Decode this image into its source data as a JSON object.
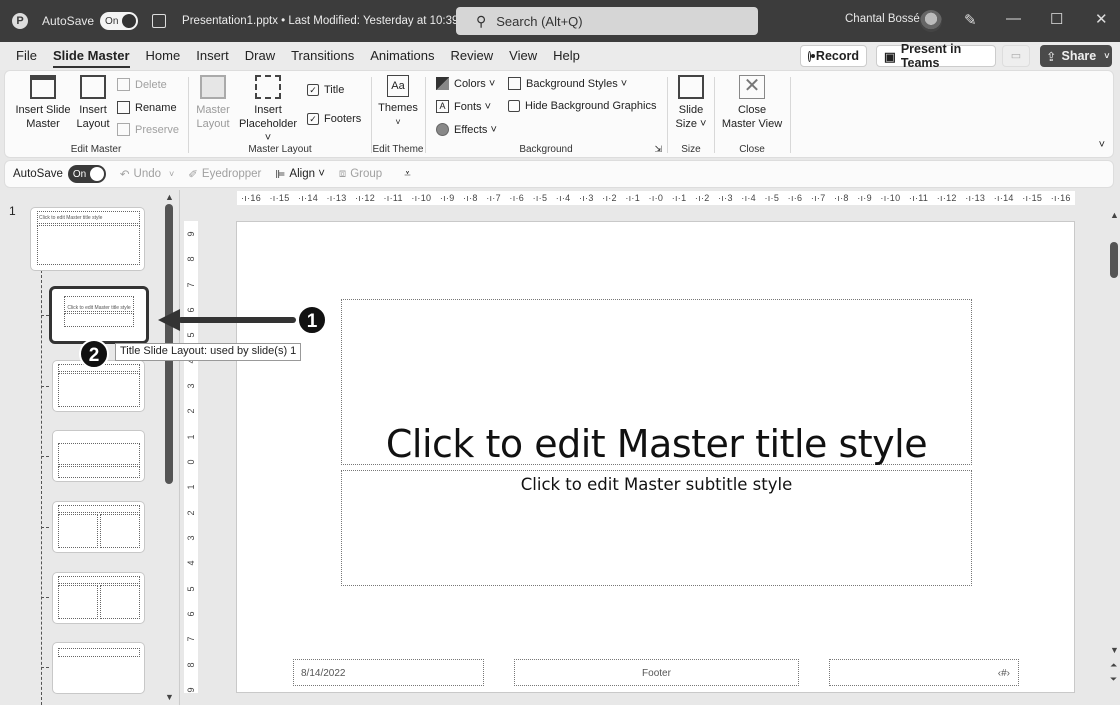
{
  "titlebar": {
    "autosave_label": "AutoSave",
    "autosave_state": "On",
    "document_title": "Presentation1.pptx • Last Modified: Yesterday at 10:39 ˅",
    "search_placeholder": "Search (Alt+Q)",
    "user_name": "Chantal Bossé",
    "minimize": "—",
    "maximize": "☐",
    "close": "✕"
  },
  "menu": {
    "tabs": [
      "File",
      "Slide Master",
      "Home",
      "Insert",
      "Draw",
      "Transitions",
      "Animations",
      "Review",
      "View",
      "Help"
    ],
    "active_tab": "Slide Master",
    "record_label": "Record",
    "present_teams_label": "Present in Teams",
    "share_label": "Share"
  },
  "ribbon": {
    "edit_master": {
      "label": "Edit Master",
      "insert_slide_master": "Insert Slide Master",
      "insert_slide_master_l1": "Insert Slide",
      "insert_slide_master_l2": "Master",
      "insert_layout_l1": "Insert",
      "insert_layout_l2": "Layout",
      "delete": "Delete",
      "rename": "Rename",
      "preserve": "Preserve"
    },
    "master_layout": {
      "label": "Master Layout",
      "master_layout_l1": "Master",
      "master_layout_l2": "Layout",
      "insert_placeholder_l1": "Insert",
      "insert_placeholder_l2": "Placeholder ˅",
      "title_checkbox": "Title",
      "title_checked": true,
      "footers_checkbox": "Footers",
      "footers_checked": true
    },
    "edit_theme": {
      "label": "Edit Theme",
      "themes": "Themes",
      "themes_chevron": "˅"
    },
    "background": {
      "label": "Background",
      "colors": "Colors ˅",
      "fonts": "Fonts ˅",
      "effects": "Effects ˅",
      "background_styles": "Background Styles ˅",
      "hide_background_graphics": "Hide Background Graphics",
      "hide_checked": false
    },
    "size": {
      "label": "Size",
      "slide_size_l1": "Slide",
      "slide_size_l2": "Size ˅"
    },
    "close": {
      "label": "Close",
      "close_master_l1": "Close",
      "close_master_l2": "Master View"
    },
    "collapse_icon": "˅"
  },
  "qat": {
    "autosave_label": "AutoSave",
    "autosave_state": "On",
    "undo": "Undo",
    "eyedropper": "Eyedropper",
    "align": "Align ˅",
    "group": "Group",
    "customize": "⩡"
  },
  "thumbnails": {
    "slide_number": "1",
    "master_title": "Click to edit Master title style",
    "layout_title": "Click to edit Master title style"
  },
  "rulers": {
    "horizontal": [
      "16",
      "15",
      "14",
      "13",
      "12",
      "11",
      "10",
      "9",
      "8",
      "7",
      "6",
      "5",
      "4",
      "3",
      "2",
      "1",
      "0",
      "1",
      "2",
      "3",
      "4",
      "5",
      "6",
      "7",
      "8",
      "9",
      "10",
      "11",
      "12",
      "13",
      "14",
      "15",
      "16"
    ],
    "vertical": [
      "9",
      "8",
      "7",
      "6",
      "5",
      "4",
      "3",
      "2",
      "1",
      "0",
      "1",
      "2",
      "3",
      "4",
      "5",
      "6",
      "7",
      "8",
      "9"
    ]
  },
  "slide": {
    "title": "Click to edit Master title style",
    "subtitle": "Click to edit Master subtitle style",
    "date": "8/14/2022",
    "footer": "Footer",
    "slide_number": "‹#›"
  },
  "annotations": {
    "callout_1": "1",
    "callout_2": "2",
    "tooltip": "Title Slide Layout: used by slide(s) 1"
  }
}
